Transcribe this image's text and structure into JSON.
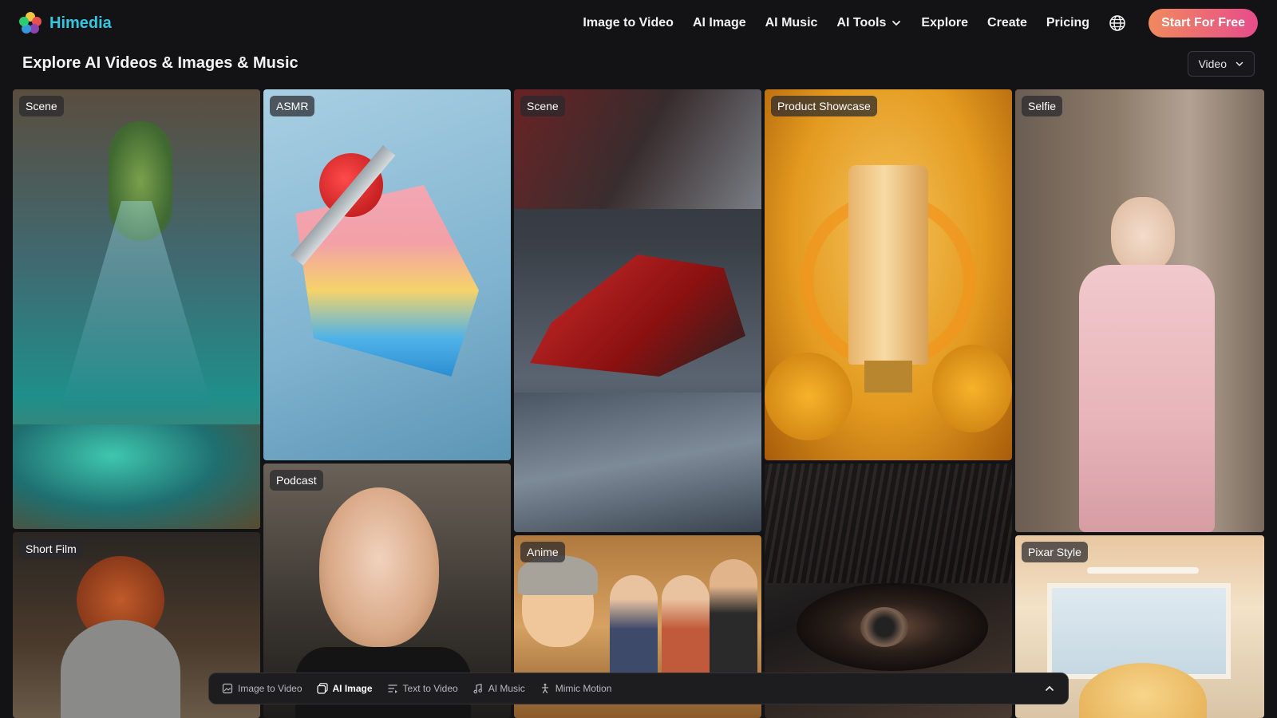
{
  "brand": {
    "name": "Himedia",
    "logo_icon": "flower-logo-icon"
  },
  "nav": {
    "items": [
      {
        "label": "Image to Video"
      },
      {
        "label": "AI Image"
      },
      {
        "label": "AI Music"
      },
      {
        "label": "AI Tools",
        "has_dropdown": true
      },
      {
        "label": "Explore"
      },
      {
        "label": "Create"
      },
      {
        "label": "Pricing"
      }
    ],
    "language_icon": "globe-icon",
    "cta_label": "Start For Free"
  },
  "page": {
    "title": "Explore AI Videos & Images & Music",
    "type_filter": {
      "selected": "Video"
    }
  },
  "cards": [
    {
      "tag": "Scene",
      "subject": "underwater cave with light rays"
    },
    {
      "tag": "ASMR",
      "subject": "knife cutting jelly strawberry cake"
    },
    {
      "tag": "Scene",
      "subject": "formula one race car"
    },
    {
      "tag": "Product Showcase",
      "subject": "hair mask tube with bees"
    },
    {
      "tag": "Selfie",
      "subject": "woman in pink ao dai"
    },
    {
      "tag": "Short Film",
      "subject": "red-haired woman in fur coat"
    },
    {
      "tag": "Podcast",
      "subject": "woman speaking into microphone"
    },
    {
      "tag": "Anime",
      "subject": "group of anime friends"
    },
    {
      "tag": "",
      "subject": "close-up of eye in snow"
    },
    {
      "tag": "Pixar Style",
      "subject": "animated character in bright room"
    }
  ],
  "dock": {
    "items": [
      {
        "label": "Image to Video",
        "icon": "image-video-icon",
        "active": false
      },
      {
        "label": "AI Image",
        "icon": "ai-image-icon",
        "active": true
      },
      {
        "label": "Text to Video",
        "icon": "text-video-icon",
        "active": false
      },
      {
        "label": "AI Music",
        "icon": "music-note-icon",
        "active": false
      },
      {
        "label": "Mimic Motion",
        "icon": "motion-figure-icon",
        "active": false
      }
    ],
    "toggle_icon": "chevron-up-icon"
  },
  "colors": {
    "background": "#131316",
    "brand": "#33c7e0",
    "cta_start": "#f08a5d",
    "cta_end": "#e74c8c"
  }
}
